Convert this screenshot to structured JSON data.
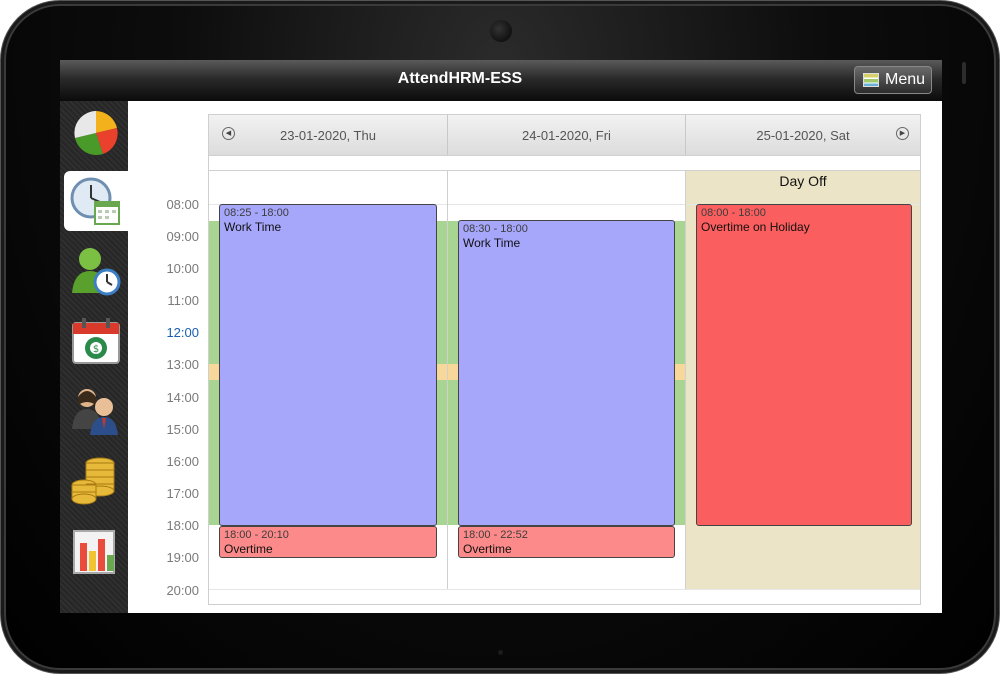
{
  "app": {
    "title": "AttendHRM-ESS",
    "menu_label": "Menu"
  },
  "sidebar": {
    "items": [
      {
        "name": "dashboard-chart-icon"
      },
      {
        "name": "attendance-clock-icon"
      },
      {
        "name": "employee-clock-icon"
      },
      {
        "name": "leave-calendar-icon"
      },
      {
        "name": "people-icon"
      },
      {
        "name": "payroll-coins-icon"
      },
      {
        "name": "reports-chart-icon"
      }
    ],
    "active_index": 1
  },
  "calendar": {
    "days": [
      {
        "label": "23-01-2020, Thu"
      },
      {
        "label": "24-01-2020, Fri"
      },
      {
        "label": "25-01-2020, Sat",
        "banner": "Day Off"
      }
    ],
    "times": [
      "08:00",
      "09:00",
      "10:00",
      "11:00",
      "12:00",
      "13:00",
      "14:00",
      "15:00",
      "16:00",
      "17:00",
      "18:00",
      "19:00",
      "20:00"
    ],
    "current_time_label": "12:00",
    "events": [
      {
        "day": 0,
        "time": "08:25 - 18:00",
        "name": "Work Time",
        "color": "#a6a6fb"
      },
      {
        "day": 0,
        "time": "18:00 - 20:10",
        "name": "Overtime",
        "color": "#fc8a8a"
      },
      {
        "day": 1,
        "time": "08:30 - 18:00",
        "name": "Work Time",
        "color": "#a6a6fb"
      },
      {
        "day": 1,
        "time": "18:00 - 22:52",
        "name": "Overtime",
        "color": "#fc8a8a"
      },
      {
        "day": 2,
        "time": "08:00 - 18:00",
        "name": "Overtime on Holiday",
        "color": "#fb5e5e"
      }
    ]
  },
  "colors": {
    "shift": "#a9d592",
    "break": "#f8d79a",
    "day_off": "#ece4c7",
    "current_time": "#1a5fb4"
  }
}
